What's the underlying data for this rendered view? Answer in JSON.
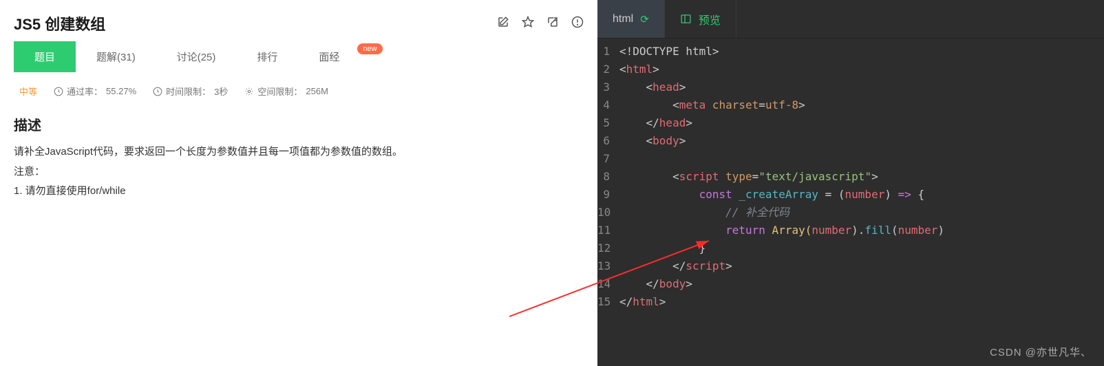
{
  "title": "JS5  创建数组",
  "tabs": [
    {
      "label": "题目",
      "active": true
    },
    {
      "label": "题解(31)"
    },
    {
      "label": "讨论(25)"
    },
    {
      "label": "排行"
    },
    {
      "label": "面经"
    }
  ],
  "new_badge": "new",
  "meta": {
    "difficulty": "中等",
    "pass_label": "通过率：",
    "pass_value": "55.27%",
    "time_label": "时间限制：",
    "time_value": "3秒",
    "space_label": "空间限制：",
    "space_value": "256M"
  },
  "desc_title": "描述",
  "desc_line1": "请补全JavaScript代码，要求返回一个长度为参数值并且每一项值都为参数值的数组。",
  "desc_line2": "注意：",
  "desc_line3": "1. 请勿直接使用for/while",
  "editor": {
    "tab_html": "html",
    "tab_preview": "预览"
  },
  "code": {
    "l1_a": "<!DOCTYPE html",
    "l1_b": ">",
    "l2_a": "<",
    "l2_b": "html",
    "l2_c": ">",
    "l3_a": "<",
    "l3_b": "head",
    "l3_c": ">",
    "l4_a": "<",
    "l4_b": "meta",
    "l4_c": " charset",
    "l4_d": "=",
    "l4_e": "utf-8",
    "l4_f": ">",
    "l5_a": "</",
    "l5_b": "head",
    "l5_c": ">",
    "l6_a": "<",
    "l6_b": "body",
    "l6_c": ">",
    "l8_a": "<",
    "l8_b": "script",
    "l8_c": " type",
    "l8_d": "=",
    "l8_e": "\"text/javascript\"",
    "l8_f": ">",
    "l9_a": "const",
    "l9_b": " _createArray",
    "l9_c": " = (",
    "l9_d": "number",
    "l9_e": ") ",
    "l9_f": "=>",
    "l9_g": " {",
    "l10_a": "// 补全代码",
    "l11_a": "return",
    "l11_b": " Array(",
    "l11_c": "number",
    "l11_d": ").",
    "l11_e": "fill",
    "l11_f": "(",
    "l11_g": "number",
    "l11_h": ")",
    "l12_a": "}",
    "l13_a": "</",
    "l13_b": "script",
    "l13_c": ">",
    "l14_a": "</",
    "l14_b": "body",
    "l14_c": ">",
    "l15_a": "</",
    "l15_b": "html",
    "l15_c": ">"
  },
  "watermark": "CSDN @亦世凡华、"
}
